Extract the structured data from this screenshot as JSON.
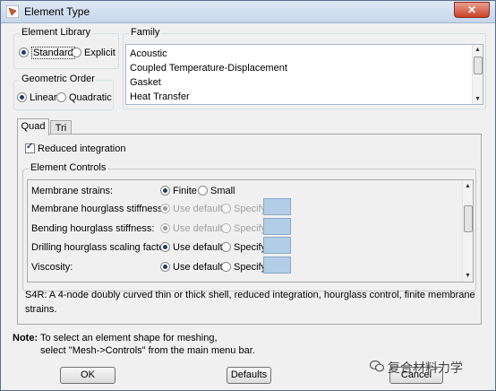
{
  "window": {
    "title": "Element Type",
    "close_label": "✕"
  },
  "element_library": {
    "label": "Element Library",
    "options": [
      {
        "label": "Standard",
        "selected": true
      },
      {
        "label": "Explicit",
        "selected": false
      }
    ]
  },
  "geometric_order": {
    "label": "Geometric Order",
    "options": [
      {
        "label": "Linear",
        "selected": true
      },
      {
        "label": "Quadratic",
        "selected": false
      }
    ]
  },
  "family": {
    "label": "Family",
    "items": [
      "Acoustic",
      "Coupled Temperature-Displacement",
      "Gasket",
      "Heat Transfer"
    ]
  },
  "tabs": [
    {
      "label": "Quad",
      "active": true
    },
    {
      "label": "Tri",
      "active": false
    }
  ],
  "reduced_integration": {
    "label": "Reduced integration",
    "checked": true
  },
  "element_controls": {
    "label": "Element Controls",
    "rows": [
      {
        "label": "Membrane strains:",
        "opt1": "Finite",
        "opt2": "Small",
        "opt1_selected": true,
        "enabled": true,
        "has_box": false
      },
      {
        "label": "Membrane hourglass stiffness:",
        "opt1": "Use default",
        "opt2": "Specify",
        "opt1_selected": true,
        "enabled": false,
        "has_box": true
      },
      {
        "label": "Bending hourglass stiffness:",
        "opt1": "Use default",
        "opt2": "Specify",
        "opt1_selected": true,
        "enabled": false,
        "has_box": true
      },
      {
        "label": "Drilling hourglass scaling factor:",
        "opt1": "Use default",
        "opt2": "Specify",
        "opt1_selected": true,
        "enabled": true,
        "has_box": true
      },
      {
        "label": "Viscosity:",
        "opt1": "Use default",
        "opt2": "Specify",
        "opt1_selected": true,
        "enabled": true,
        "has_box": true
      }
    ]
  },
  "description": {
    "line1": "S4R:  A 4-node doubly curved thin or thick shell, reduced integration, hourglass control, finite membrane",
    "line2": "strains."
  },
  "note": {
    "label": "Note:",
    "line1": "To select an element shape for meshing,",
    "line2": "select \"Mesh->Controls\" from the main menu bar."
  },
  "buttons": {
    "ok": "OK",
    "defaults": "Defaults",
    "cancel": "Cancel"
  },
  "watermark": "复合材料力学",
  "colors": {
    "specify_box": "#b3cde6",
    "titlebar": "#c6d6ea",
    "close": "#c8412a"
  }
}
